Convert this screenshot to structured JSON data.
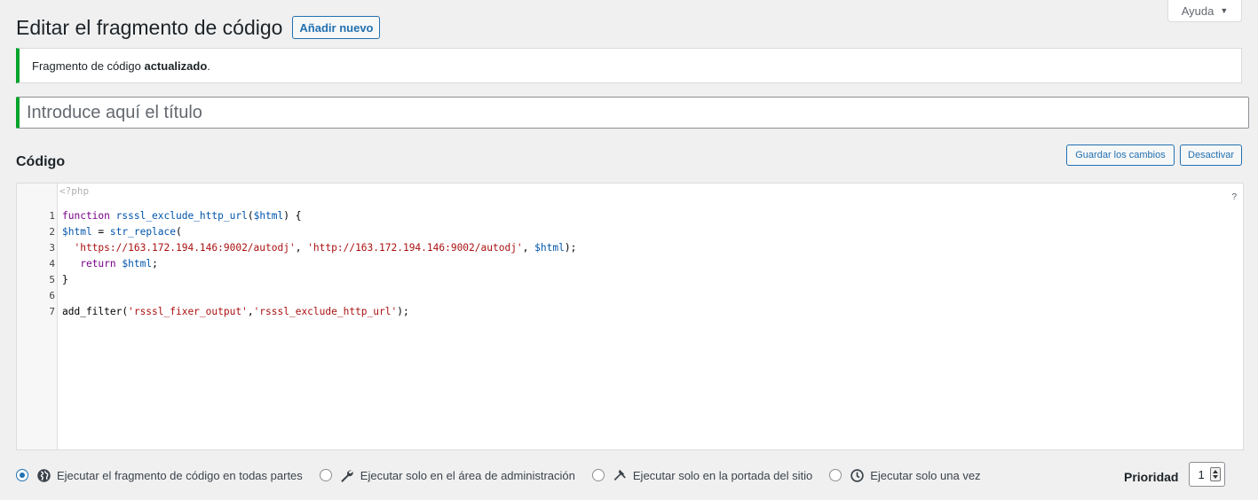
{
  "help_tab": {
    "label": "Ayuda"
  },
  "header": {
    "title": "Editar el fragmento de código",
    "add_new": "Añadir nuevo"
  },
  "notice": {
    "text_prefix": "Fragmento de código ",
    "text_bold": "actualizado",
    "text_suffix": "."
  },
  "title_field": {
    "placeholder": "Introduce aquí el título",
    "value": ""
  },
  "code_section": {
    "heading": "Código",
    "save_button": "Guardar los cambios",
    "deactivate_button": "Desactivar"
  },
  "editor": {
    "php_open_tag": "<?php",
    "help_icon": "?",
    "lines": [
      {
        "num": "1",
        "tokens": [
          {
            "t": "kw",
            "v": "function"
          },
          {
            "t": "plain",
            "v": " "
          },
          {
            "t": "fn",
            "v": "rsssl_exclude_http_url"
          },
          {
            "t": "plain",
            "v": "("
          },
          {
            "t": "var",
            "v": "$html"
          },
          {
            "t": "plain",
            "v": ") {"
          }
        ]
      },
      {
        "num": "2",
        "tokens": [
          {
            "t": "var",
            "v": "$html"
          },
          {
            "t": "plain",
            "v": " = "
          },
          {
            "t": "fn",
            "v": "str_replace"
          },
          {
            "t": "plain",
            "v": "("
          }
        ]
      },
      {
        "num": "3",
        "tokens": [
          {
            "t": "plain",
            "v": "  "
          },
          {
            "t": "str",
            "v": "'https://163.172.194.146:9002/autodj'"
          },
          {
            "t": "plain",
            "v": ", "
          },
          {
            "t": "str",
            "v": "'http://163.172.194.146:9002/autodj'"
          },
          {
            "t": "plain",
            "v": ", "
          },
          {
            "t": "var",
            "v": "$html"
          },
          {
            "t": "plain",
            "v": ");"
          }
        ]
      },
      {
        "num": "4",
        "tokens": [
          {
            "t": "plain",
            "v": "   "
          },
          {
            "t": "kw",
            "v": "return"
          },
          {
            "t": "plain",
            "v": " "
          },
          {
            "t": "var",
            "v": "$html"
          },
          {
            "t": "plain",
            "v": ";"
          }
        ]
      },
      {
        "num": "5",
        "tokens": [
          {
            "t": "plain",
            "v": "}"
          }
        ]
      },
      {
        "num": "6",
        "tokens": []
      },
      {
        "num": "7",
        "tokens": [
          {
            "t": "plain",
            "v": "add_filter("
          },
          {
            "t": "str",
            "v": "'rsssl_fixer_output'"
          },
          {
            "t": "plain",
            "v": ","
          },
          {
            "t": "str",
            "v": "'rsssl_exclude_http_url'"
          },
          {
            "t": "plain",
            "v": ");"
          }
        ]
      }
    ]
  },
  "scope_options": [
    {
      "label": "Ejecutar el fragmento de código en todas partes",
      "icon": "globe-icon",
      "checked": true
    },
    {
      "label": "Ejecutar solo en el área de administración",
      "icon": "wrench-icon",
      "checked": false
    },
    {
      "label": "Ejecutar solo en la portada del sitio",
      "icon": "hammer-icon",
      "checked": false
    },
    {
      "label": "Ejecutar solo una vez",
      "icon": "clock-icon",
      "checked": false
    }
  ],
  "priority": {
    "label": "Prioridad",
    "value": "1"
  },
  "colors": {
    "accent": "#2271b1",
    "success": "#00a32a",
    "background": "#f0f0f1"
  }
}
